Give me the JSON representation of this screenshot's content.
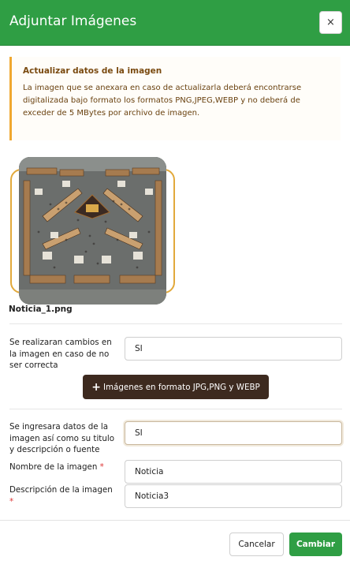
{
  "modal": {
    "title": "Adjuntar Imágenes",
    "close_symbol": "×",
    "close_icon": "close-icon"
  },
  "notice": {
    "title": "Actualizar datos de la imagen",
    "body": "La imagen que se anexara en caso de actualizarla deberá encontrarse digitalizada bajo formato los formatos PNG,JPEG,WEBP y no deberá de exceder de 5 MBytes por archivo de imagen.",
    "accent_color": "#f0a830"
  },
  "image": {
    "filename": "Noticia_1.png",
    "frame_color": "#e2a93b"
  },
  "form": {
    "changes_question": "Se realizaran cambios en la imagen en caso de no ser correcta",
    "changes_value": "SI",
    "upload_button_icon": "plus-icon",
    "upload_button_plus": "+",
    "upload_button_label": "Imágenes en formato JPG,PNG y WEBP",
    "data_question": "Se ingresara datos de la imagen así como su titulo y descripción o fuente",
    "data_value": "SI",
    "name_label": "Nombre de la imagen",
    "name_value": "Noticia",
    "description_label": "Descripción de la imagen",
    "description_value": "Noticia3",
    "required_mark": "*"
  },
  "footer": {
    "cancel_label": "Cancelar",
    "submit_label": "Cambiar"
  },
  "colors": {
    "primary": "#2f9e44",
    "dark_button": "#3d2a1f"
  }
}
